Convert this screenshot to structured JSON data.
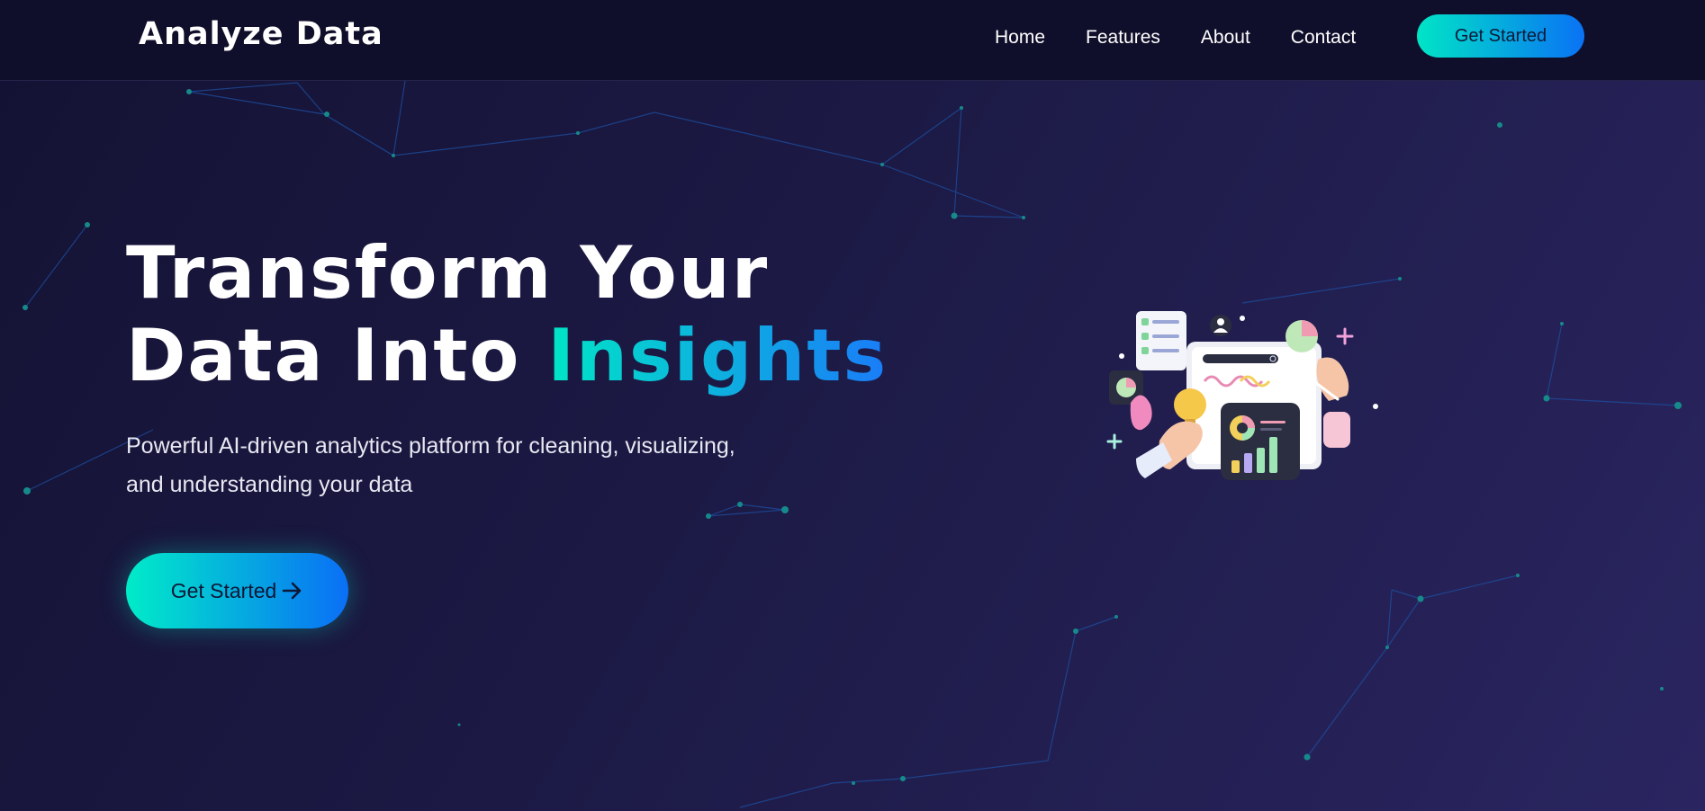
{
  "nav": {
    "logo": "Analyze Data",
    "links": [
      "Home",
      "Features",
      "About",
      "Contact"
    ],
    "cta_label": "Get Started"
  },
  "hero": {
    "title_line1": "Transform Your",
    "title_line2_prefix": "Data Into ",
    "title_line2_accent": "Insights",
    "subtitle_line1": "Powerful AI-driven analytics platform for cleaning, visualizing,",
    "subtitle_line2": "and understanding your data",
    "cta_label": "Get Started",
    "cta_icon": "arrow-right-icon"
  },
  "colors": {
    "background": "#1c1a45",
    "nav_background": "#100f2b",
    "accent_start": "#00e5c6",
    "accent_end": "#0a72f5"
  }
}
